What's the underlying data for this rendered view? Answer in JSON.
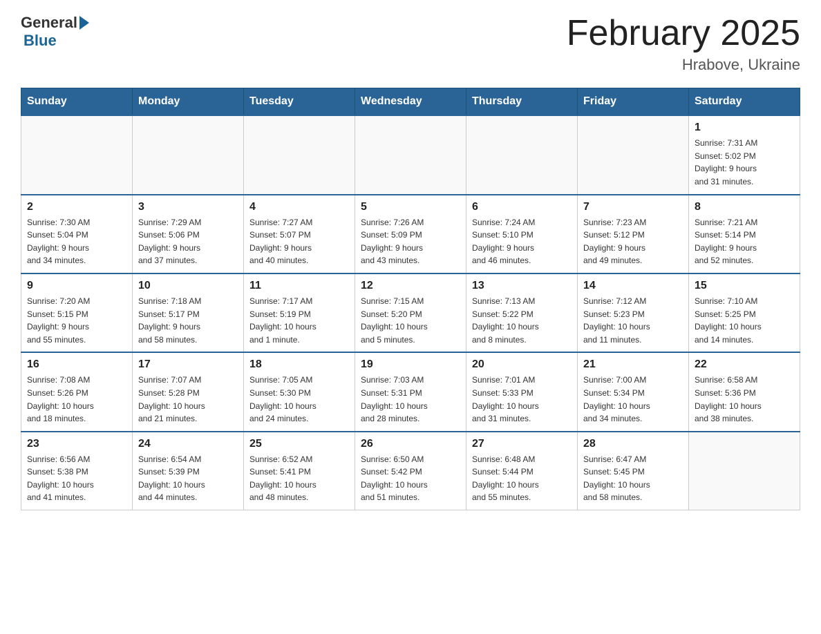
{
  "header": {
    "logo_general": "General",
    "logo_blue": "Blue",
    "title": "February 2025",
    "subtitle": "Hrabove, Ukraine"
  },
  "weekdays": [
    "Sunday",
    "Monday",
    "Tuesday",
    "Wednesday",
    "Thursday",
    "Friday",
    "Saturday"
  ],
  "weeks": [
    [
      {
        "day": "",
        "info": ""
      },
      {
        "day": "",
        "info": ""
      },
      {
        "day": "",
        "info": ""
      },
      {
        "day": "",
        "info": ""
      },
      {
        "day": "",
        "info": ""
      },
      {
        "day": "",
        "info": ""
      },
      {
        "day": "1",
        "info": "Sunrise: 7:31 AM\nSunset: 5:02 PM\nDaylight: 9 hours\nand 31 minutes."
      }
    ],
    [
      {
        "day": "2",
        "info": "Sunrise: 7:30 AM\nSunset: 5:04 PM\nDaylight: 9 hours\nand 34 minutes."
      },
      {
        "day": "3",
        "info": "Sunrise: 7:29 AM\nSunset: 5:06 PM\nDaylight: 9 hours\nand 37 minutes."
      },
      {
        "day": "4",
        "info": "Sunrise: 7:27 AM\nSunset: 5:07 PM\nDaylight: 9 hours\nand 40 minutes."
      },
      {
        "day": "5",
        "info": "Sunrise: 7:26 AM\nSunset: 5:09 PM\nDaylight: 9 hours\nand 43 minutes."
      },
      {
        "day": "6",
        "info": "Sunrise: 7:24 AM\nSunset: 5:10 PM\nDaylight: 9 hours\nand 46 minutes."
      },
      {
        "day": "7",
        "info": "Sunrise: 7:23 AM\nSunset: 5:12 PM\nDaylight: 9 hours\nand 49 minutes."
      },
      {
        "day": "8",
        "info": "Sunrise: 7:21 AM\nSunset: 5:14 PM\nDaylight: 9 hours\nand 52 minutes."
      }
    ],
    [
      {
        "day": "9",
        "info": "Sunrise: 7:20 AM\nSunset: 5:15 PM\nDaylight: 9 hours\nand 55 minutes."
      },
      {
        "day": "10",
        "info": "Sunrise: 7:18 AM\nSunset: 5:17 PM\nDaylight: 9 hours\nand 58 minutes."
      },
      {
        "day": "11",
        "info": "Sunrise: 7:17 AM\nSunset: 5:19 PM\nDaylight: 10 hours\nand 1 minute."
      },
      {
        "day": "12",
        "info": "Sunrise: 7:15 AM\nSunset: 5:20 PM\nDaylight: 10 hours\nand 5 minutes."
      },
      {
        "day": "13",
        "info": "Sunrise: 7:13 AM\nSunset: 5:22 PM\nDaylight: 10 hours\nand 8 minutes."
      },
      {
        "day": "14",
        "info": "Sunrise: 7:12 AM\nSunset: 5:23 PM\nDaylight: 10 hours\nand 11 minutes."
      },
      {
        "day": "15",
        "info": "Sunrise: 7:10 AM\nSunset: 5:25 PM\nDaylight: 10 hours\nand 14 minutes."
      }
    ],
    [
      {
        "day": "16",
        "info": "Sunrise: 7:08 AM\nSunset: 5:26 PM\nDaylight: 10 hours\nand 18 minutes."
      },
      {
        "day": "17",
        "info": "Sunrise: 7:07 AM\nSunset: 5:28 PM\nDaylight: 10 hours\nand 21 minutes."
      },
      {
        "day": "18",
        "info": "Sunrise: 7:05 AM\nSunset: 5:30 PM\nDaylight: 10 hours\nand 24 minutes."
      },
      {
        "day": "19",
        "info": "Sunrise: 7:03 AM\nSunset: 5:31 PM\nDaylight: 10 hours\nand 28 minutes."
      },
      {
        "day": "20",
        "info": "Sunrise: 7:01 AM\nSunset: 5:33 PM\nDaylight: 10 hours\nand 31 minutes."
      },
      {
        "day": "21",
        "info": "Sunrise: 7:00 AM\nSunset: 5:34 PM\nDaylight: 10 hours\nand 34 minutes."
      },
      {
        "day": "22",
        "info": "Sunrise: 6:58 AM\nSunset: 5:36 PM\nDaylight: 10 hours\nand 38 minutes."
      }
    ],
    [
      {
        "day": "23",
        "info": "Sunrise: 6:56 AM\nSunset: 5:38 PM\nDaylight: 10 hours\nand 41 minutes."
      },
      {
        "day": "24",
        "info": "Sunrise: 6:54 AM\nSunset: 5:39 PM\nDaylight: 10 hours\nand 44 minutes."
      },
      {
        "day": "25",
        "info": "Sunrise: 6:52 AM\nSunset: 5:41 PM\nDaylight: 10 hours\nand 48 minutes."
      },
      {
        "day": "26",
        "info": "Sunrise: 6:50 AM\nSunset: 5:42 PM\nDaylight: 10 hours\nand 51 minutes."
      },
      {
        "day": "27",
        "info": "Sunrise: 6:48 AM\nSunset: 5:44 PM\nDaylight: 10 hours\nand 55 minutes."
      },
      {
        "day": "28",
        "info": "Sunrise: 6:47 AM\nSunset: 5:45 PM\nDaylight: 10 hours\nand 58 minutes."
      },
      {
        "day": "",
        "info": ""
      }
    ]
  ]
}
